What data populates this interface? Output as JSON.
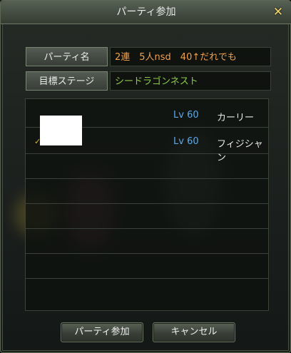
{
  "dialog": {
    "title": "パーティ参加",
    "close_icon": "close-icon"
  },
  "fields": {
    "party_name_label": "パーティ名",
    "party_name_value": "2連　5人nsd　40↑だれでも",
    "stage_label": "目標ステージ",
    "stage_value": "シードラゴンネスト"
  },
  "members": [
    {
      "level": "Lv 60",
      "class": "カーリー"
    },
    {
      "level": "Lv 60",
      "class": "フィジシャン"
    }
  ],
  "empty_slot_count": 6,
  "buttons": {
    "join": "パーティ参加",
    "cancel": "キャンセル"
  },
  "colors": {
    "party_name": "#f0a050",
    "stage": "#8ccc47",
    "level": "#5fa8e6",
    "close": "#f3d36a"
  }
}
